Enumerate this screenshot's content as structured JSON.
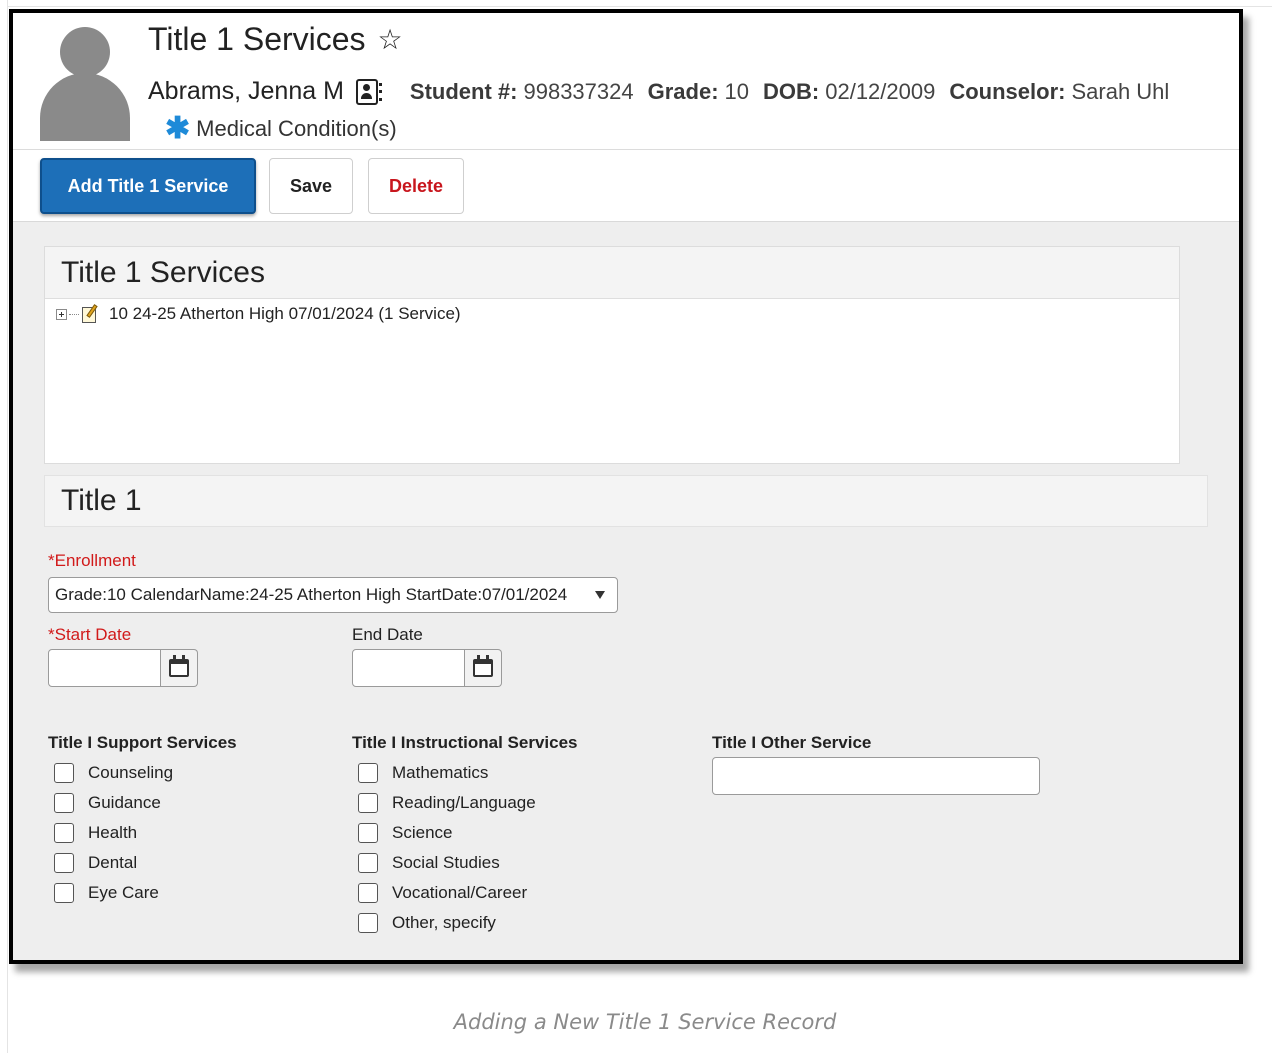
{
  "header": {
    "title": "Title 1 Services",
    "student_name": "Abrams, Jenna M",
    "student_num_label": "Student #:",
    "student_num": "998337324",
    "grade_label": "Grade:",
    "grade": "10",
    "dob_label": "DOB:",
    "dob": "02/12/2009",
    "counselor_label": "Counselor:",
    "counselor": "Sarah Uhl",
    "medical_label": "Medical Condition(s)"
  },
  "toolbar": {
    "add_label": "Add Title 1 Service",
    "save_label": "Save",
    "delete_label": "Delete"
  },
  "services_panel": {
    "heading": "Title 1 Services",
    "rows": [
      {
        "label": "10 24-25 Atherton High 07/01/2024 (1 Service)"
      }
    ]
  },
  "form": {
    "heading": "Title 1",
    "enrollment_label": "*Enrollment",
    "enrollment_value": "Grade:10 CalendarName:24-25 Atherton High StartDate:07/01/2024",
    "start_date_label": "*Start Date",
    "end_date_label": "End Date",
    "support_heading": "Title I Support Services",
    "support_options": [
      "Counseling",
      "Guidance",
      "Health",
      "Dental",
      "Eye Care"
    ],
    "instructional_heading": "Title I Instructional Services",
    "instructional_options": [
      "Mathematics",
      "Reading/Language",
      "Science",
      "Social Studies",
      "Vocational/Career",
      "Other, specify"
    ],
    "other_heading": "Title I Other Service"
  },
  "caption": "Adding a New Title 1 Service Record",
  "colors": {
    "primary": "#1d6fb8",
    "danger": "#c8161d",
    "required": "#d11a1a",
    "medical_icon": "#1e8ad8"
  },
  "icons": [
    "star-icon",
    "contact-card-icon",
    "asterisk-icon",
    "expand-icon",
    "note-icon",
    "calendar-icon",
    "caret-down-icon"
  ]
}
